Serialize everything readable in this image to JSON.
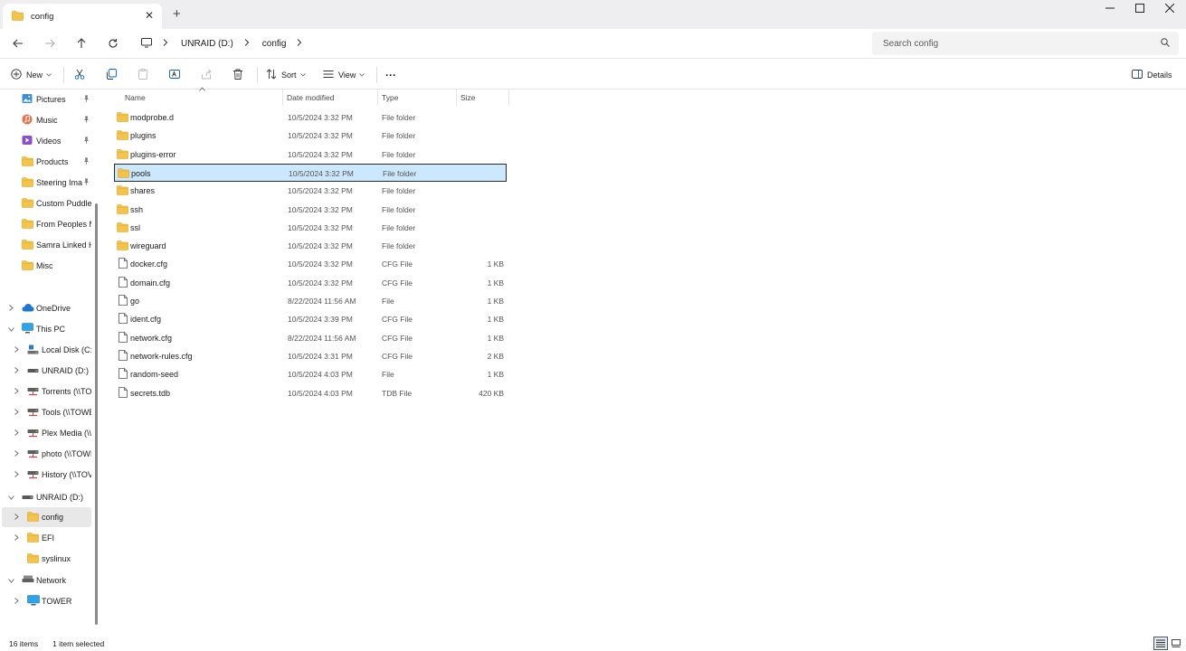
{
  "window": {
    "tab_title": "config",
    "new_tab": "+",
    "close_tab": "✕",
    "minimize": "—",
    "maximize": "☐",
    "close": "✕"
  },
  "address": {
    "segments": [
      "UNRAID (D:)",
      "config"
    ],
    "search_placeholder": "Search config"
  },
  "toolbar": {
    "new_label": "New",
    "sort_label": "Sort",
    "view_label": "View",
    "more_label": "···",
    "details_label": "Details"
  },
  "sidebar": {
    "items": [
      {
        "label": "Pictures",
        "icon": "pictures-icon",
        "pinned": true
      },
      {
        "label": "Music",
        "icon": "music-icon",
        "pinned": true
      },
      {
        "label": "Videos",
        "icon": "videos-icon",
        "pinned": true
      },
      {
        "label": "Products",
        "icon": "folder-icon",
        "pinned": true
      },
      {
        "label": "Steering Ima",
        "icon": "folder-icon",
        "pinned": true
      },
      {
        "label": "Custom Puddle",
        "icon": "folder-icon"
      },
      {
        "label": "From Peoples M",
        "icon": "folder-icon"
      },
      {
        "label": "Samra Linked H",
        "icon": "folder-icon"
      },
      {
        "label": "Misc",
        "icon": "folder-icon"
      },
      {
        "label": "OneDrive",
        "icon": "cloud-icon"
      },
      {
        "label": "This PC",
        "icon": "pc-icon"
      },
      {
        "label": "Local Disk (C:)",
        "icon": "disk-icon"
      },
      {
        "label": "UNRAID (D:)",
        "icon": "drive-icon"
      },
      {
        "label": "Torrents (\\\\TOW",
        "icon": "network-drive-icon"
      },
      {
        "label": "Tools (\\\\TOWE",
        "icon": "network-drive-icon"
      },
      {
        "label": "Plex Media (\\\\",
        "icon": "network-drive-icon"
      },
      {
        "label": "photo (\\\\TOWI",
        "icon": "network-drive-icon"
      },
      {
        "label": "History (\\\\TOV",
        "icon": "network-drive-icon"
      },
      {
        "label": "UNRAID (D:)",
        "icon": "drive-icon"
      },
      {
        "label": "config",
        "icon": "folder-icon",
        "selected": true
      },
      {
        "label": "EFI",
        "icon": "folder-icon"
      },
      {
        "label": "syslinux",
        "icon": "folder-icon"
      },
      {
        "label": "Network",
        "icon": "network-icon"
      },
      {
        "label": "TOWER",
        "icon": "computer-icon"
      }
    ]
  },
  "columns": {
    "name": "Name",
    "date": "Date modified",
    "type": "Type",
    "size": "Size"
  },
  "files": [
    {
      "name": "modprobe.d",
      "date": "10/5/2024 3:32 PM",
      "type": "File folder",
      "size": "",
      "kind": "folder"
    },
    {
      "name": "plugins",
      "date": "10/5/2024 3:32 PM",
      "type": "File folder",
      "size": "",
      "kind": "folder"
    },
    {
      "name": "plugins-error",
      "date": "10/5/2024 3:32 PM",
      "type": "File folder",
      "size": "",
      "kind": "folder"
    },
    {
      "name": "pools",
      "date": "10/5/2024 3:32 PM",
      "type": "File folder",
      "size": "",
      "kind": "folder",
      "selected": true
    },
    {
      "name": "shares",
      "date": "10/5/2024 3:32 PM",
      "type": "File folder",
      "size": "",
      "kind": "folder"
    },
    {
      "name": "ssh",
      "date": "10/5/2024 3:32 PM",
      "type": "File folder",
      "size": "",
      "kind": "folder"
    },
    {
      "name": "ssl",
      "date": "10/5/2024 3:32 PM",
      "type": "File folder",
      "size": "",
      "kind": "folder"
    },
    {
      "name": "wireguard",
      "date": "10/5/2024 3:32 PM",
      "type": "File folder",
      "size": "",
      "kind": "folder"
    },
    {
      "name": "docker.cfg",
      "date": "10/5/2024 3:32 PM",
      "type": "CFG File",
      "size": "1 KB",
      "kind": "file"
    },
    {
      "name": "domain.cfg",
      "date": "10/5/2024 3:32 PM",
      "type": "CFG File",
      "size": "1 KB",
      "kind": "file"
    },
    {
      "name": "go",
      "date": "8/22/2024 11:56 AM",
      "type": "File",
      "size": "1 KB",
      "kind": "file"
    },
    {
      "name": "ident.cfg",
      "date": "10/5/2024 3:39 PM",
      "type": "CFG File",
      "size": "1 KB",
      "kind": "file"
    },
    {
      "name": "network.cfg",
      "date": "8/22/2024 11:56 AM",
      "type": "CFG File",
      "size": "1 KB",
      "kind": "file"
    },
    {
      "name": "network-rules.cfg",
      "date": "10/5/2024 3:31 PM",
      "type": "CFG File",
      "size": "2 KB",
      "kind": "file"
    },
    {
      "name": "random-seed",
      "date": "10/5/2024 4:03 PM",
      "type": "File",
      "size": "1 KB",
      "kind": "file"
    },
    {
      "name": "secrets.tdb",
      "date": "10/5/2024 4:03 PM",
      "type": "TDB File",
      "size": "420 KB",
      "kind": "file"
    }
  ],
  "status": {
    "item_count": "16 items",
    "selection": "1 item selected"
  },
  "colors": {
    "folder": "#f4c34a",
    "folder_dark": "#e8a91f",
    "selection_bg": "#cce8ff",
    "sidebar_selected": "#e8e8e8",
    "accent": "#0067c0"
  }
}
